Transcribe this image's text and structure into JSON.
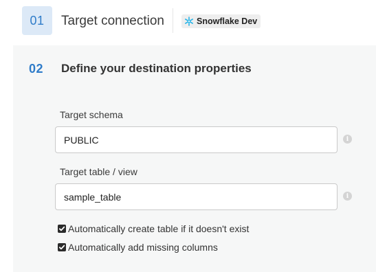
{
  "step1": {
    "number": "01",
    "title": "Target connection",
    "connection_name": "Snowflake Dev",
    "connection_icon": "snowflake-icon",
    "accent_color": "#2f7cc9"
  },
  "step2": {
    "number": "02",
    "title": "Define your destination properties",
    "schema": {
      "label": "Target schema",
      "value": "PUBLIC"
    },
    "table": {
      "label": "Target table / view",
      "value": "sample_table"
    },
    "options": [
      {
        "label": "Automatically create table if it doesn't exist",
        "checked": true
      },
      {
        "label": "Automatically add missing columns",
        "checked": true
      }
    ]
  }
}
